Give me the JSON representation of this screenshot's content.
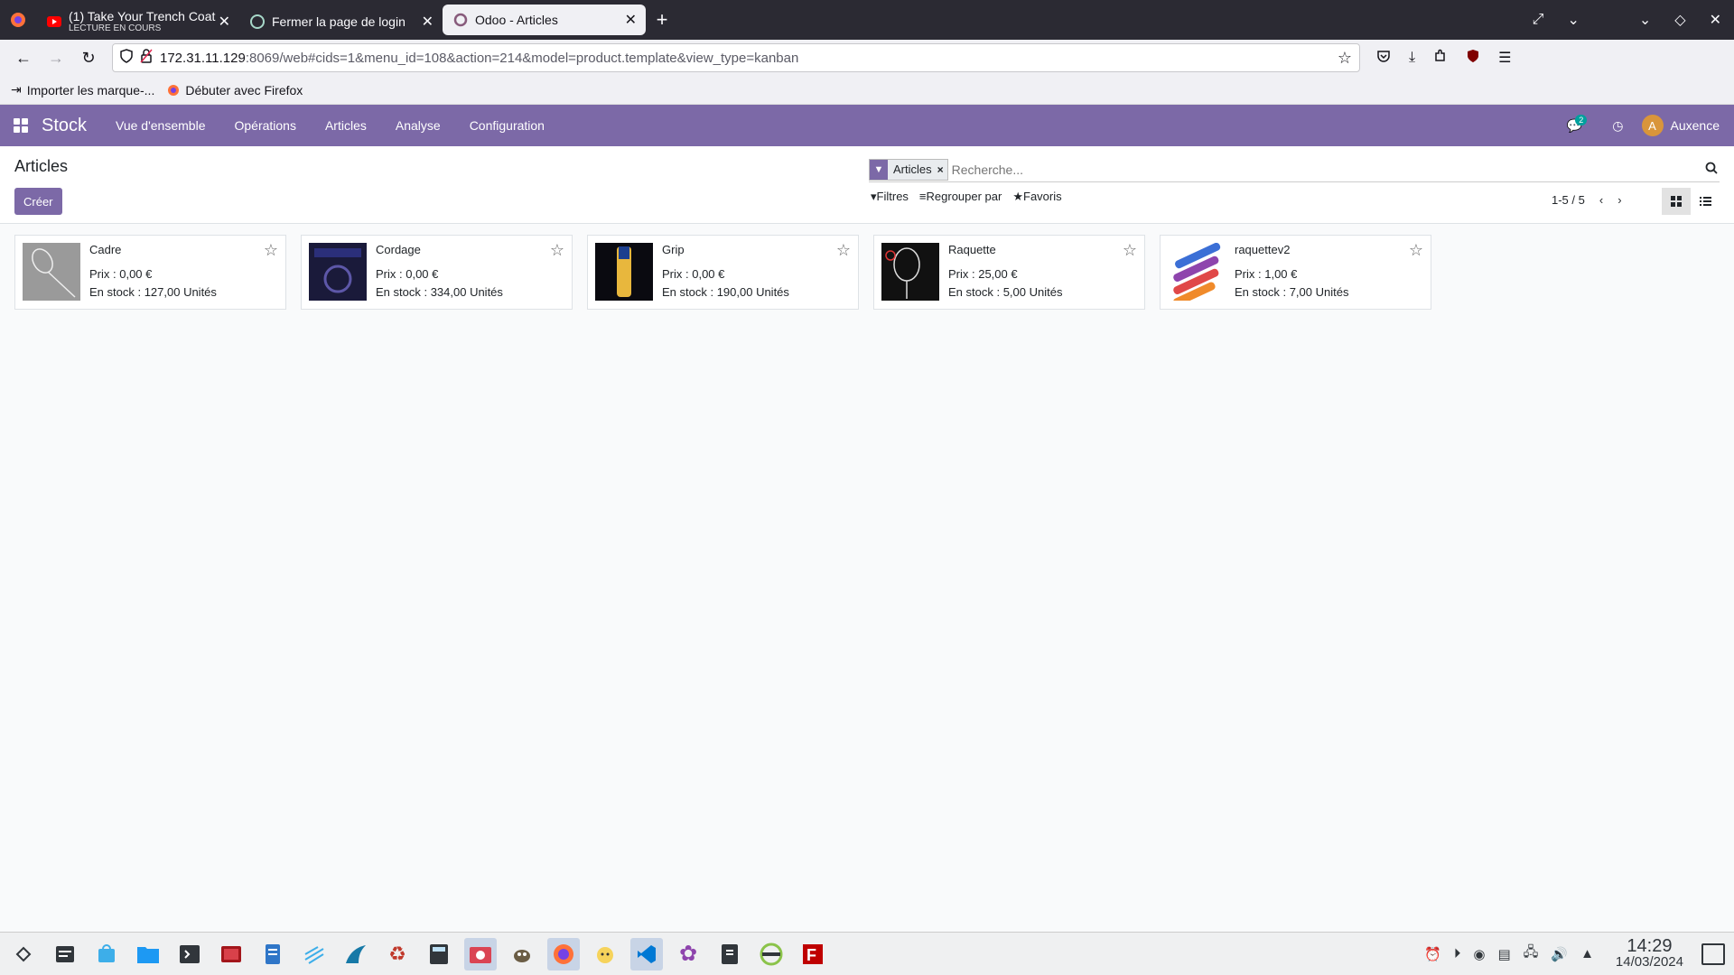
{
  "browser": {
    "tabs": [
      {
        "title": "(1) Take Your Trench Coat",
        "subtitle": "LECTURE EN COURS",
        "icon": "youtube-icon"
      },
      {
        "title": "Fermer la page de login",
        "icon": "chatgpt-icon"
      },
      {
        "title": "Odoo - Articles",
        "icon": "odoo-icon"
      }
    ],
    "url_host": "172.31.11.129",
    "url_path": ":8069/web#cids=1&menu_id=108&action=214&model=product.template&view_type=kanban",
    "bookmarks": [
      "Importer les marque-...",
      "Débuter avec Firefox"
    ]
  },
  "odoo": {
    "app_name": "Stock",
    "menus": [
      "Vue d'ensemble",
      "Opérations",
      "Articles",
      "Analyse",
      "Configuration"
    ],
    "message_count": "2",
    "user_initial": "A",
    "user_name": "Auxence",
    "breadcrumb": "Articles",
    "create_label": "Créer",
    "facet_label": "Articles",
    "search_placeholder": "Recherche...",
    "filters_label": "Filtres",
    "groupby_label": "Regrouper par",
    "favorites_label": "Favoris",
    "pager": "1-5 / 5",
    "accent_color": "#7c69a7"
  },
  "products": [
    {
      "name": "Cadre",
      "price": "Prix : 0,00 €",
      "stock": "En stock : 127,00 Unités"
    },
    {
      "name": "Cordage",
      "price": "Prix : 0,00 €",
      "stock": "En stock : 334,00 Unités"
    },
    {
      "name": "Grip",
      "price": "Prix : 0,00 €",
      "stock": "En stock : 190,00 Unités"
    },
    {
      "name": "Raquette",
      "price": "Prix : 25,00 €",
      "stock": "En stock : 5,00 Unités"
    },
    {
      "name": "raquettev2",
      "price": "Prix : 1,00 €",
      "stock": "En stock : 7,00 Unités"
    }
  ],
  "taskbar": {
    "time": "14:29",
    "date": "14/03/2024"
  }
}
